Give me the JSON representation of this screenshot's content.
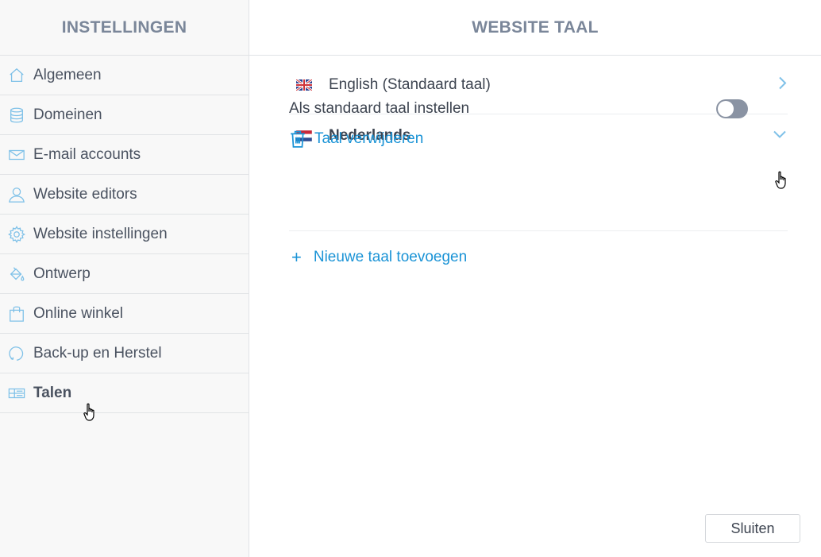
{
  "sidebar": {
    "title": "INSTELLINGEN",
    "items": [
      {
        "label": "Algemeen",
        "icon": "home-icon"
      },
      {
        "label": "Domeinen",
        "icon": "database-icon"
      },
      {
        "label": "E-mail accounts",
        "icon": "envelope-icon"
      },
      {
        "label": "Website editors",
        "icon": "user-icon"
      },
      {
        "label": "Website instellingen",
        "icon": "gear-icon"
      },
      {
        "label": "Ontwerp",
        "icon": "paint-bucket-icon"
      },
      {
        "label": "Online winkel",
        "icon": "shopping-bag-icon"
      },
      {
        "label": "Back-up en Herstel",
        "icon": "restore-icon"
      },
      {
        "label": "Talen",
        "icon": "languages-icon",
        "active": true
      }
    ]
  },
  "main": {
    "title": "WEBSITE TAAL",
    "languages": [
      {
        "label": "English (Standaard taal)",
        "flag": "uk-flag-icon",
        "expanded": false
      },
      {
        "label": "Nederlands",
        "flag": "netherlands-flag-icon",
        "expanded": true
      }
    ],
    "expanded": {
      "set_default_label": "Als standaard taal instellen",
      "set_default_on": false,
      "delete_label": "Taal verwijderen"
    },
    "add_language_label": "Nieuwe taal toevoegen",
    "close_label": "Sluiten"
  },
  "colors": {
    "accent": "#1a93d6",
    "icon": "#7fc1e8",
    "header_text": "#7a8699",
    "toggle_off": "#8a93a3"
  }
}
